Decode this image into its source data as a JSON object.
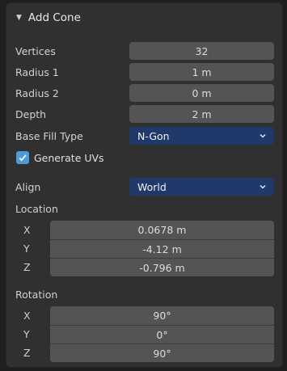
{
  "panel": {
    "title": "Add Cone",
    "collapse_icon": "triangle-down-icon"
  },
  "fields": {
    "vertices": {
      "label": "Vertices",
      "value": "32"
    },
    "radius1": {
      "label": "Radius 1",
      "value": "1 m"
    },
    "radius2": {
      "label": "Radius 2",
      "value": "0 m"
    },
    "depth": {
      "label": "Depth",
      "value": "2 m"
    }
  },
  "base_fill": {
    "label": "Base Fill Type",
    "value": "N-Gon"
  },
  "generate_uvs": {
    "label": "Generate UVs",
    "checked": true
  },
  "align": {
    "label": "Align",
    "value": "World"
  },
  "location": {
    "label": "Location",
    "x": {
      "axis": "X",
      "value": "0.0678 m"
    },
    "y": {
      "axis": "Y",
      "value": "-4.12 m"
    },
    "z": {
      "axis": "Z",
      "value": "-0.796 m"
    }
  },
  "rotation": {
    "label": "Rotation",
    "x": {
      "axis": "X",
      "value": "90°"
    },
    "y": {
      "axis": "Y",
      "value": "0°"
    },
    "z": {
      "axis": "Z",
      "value": "90°"
    }
  },
  "colors": {
    "panel_bg": "#303030",
    "field_bg": "#545454",
    "select_bg": "#1f3a6a",
    "checkbox_accent": "#4a9cd6"
  }
}
